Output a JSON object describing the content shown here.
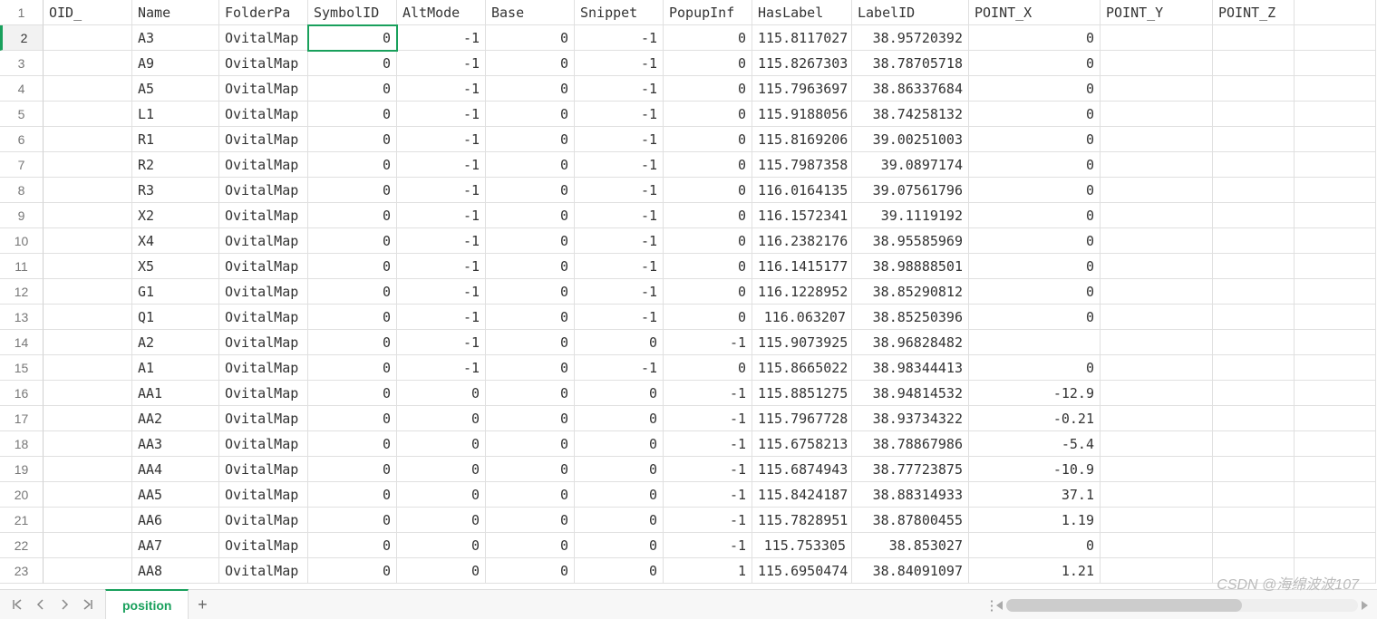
{
  "columns": [
    "OID_",
    "Name",
    "FolderPa",
    "SymbolID",
    "AltMode",
    "Base",
    "Snippet",
    "PopupInf",
    "HasLabel",
    "LabelID",
    "POINT_X",
    "POINT_Y",
    "POINT_Z"
  ],
  "sheet_tab": "position",
  "watermark": "CSDN @海绵波波107",
  "active_row_header": 2,
  "active_col_index": 3,
  "rows": [
    {
      "n": 1,
      "oid": "",
      "name": "",
      "folder": "",
      "sym": "",
      "alt": "",
      "base": "",
      "snip": "",
      "popup": "",
      "haslbl": "",
      "lbl": "",
      "px": "",
      "py": "",
      "pz": ""
    },
    {
      "n": 2,
      "oid": "",
      "name": "A3",
      "folder": "OvitalMap",
      "sym": "0",
      "alt": "-1",
      "base": "0",
      "snip": "-1",
      "popup": "0",
      "haslbl": "115.8117027",
      "lbl": "38.95720392",
      "px": "0",
      "py": "",
      "pz": ""
    },
    {
      "n": 3,
      "oid": "",
      "name": "A9",
      "folder": "OvitalMap",
      "sym": "0",
      "alt": "-1",
      "base": "0",
      "snip": "-1",
      "popup": "0",
      "haslbl": "115.8267303",
      "lbl": "38.78705718",
      "px": "0",
      "py": "",
      "pz": ""
    },
    {
      "n": 4,
      "oid": "",
      "name": "A5",
      "folder": "OvitalMap",
      "sym": "0",
      "alt": "-1",
      "base": "0",
      "snip": "-1",
      "popup": "0",
      "haslbl": "115.7963697",
      "lbl": "38.86337684",
      "px": "0",
      "py": "",
      "pz": ""
    },
    {
      "n": 5,
      "oid": "",
      "name": "L1",
      "folder": "OvitalMap",
      "sym": "0",
      "alt": "-1",
      "base": "0",
      "snip": "-1",
      "popup": "0",
      "haslbl": "115.9188056",
      "lbl": "38.74258132",
      "px": "0",
      "py": "",
      "pz": ""
    },
    {
      "n": 6,
      "oid": "",
      "name": "R1",
      "folder": "OvitalMap",
      "sym": "0",
      "alt": "-1",
      "base": "0",
      "snip": "-1",
      "popup": "0",
      "haslbl": "115.8169206",
      "lbl": "39.00251003",
      "px": "0",
      "py": "",
      "pz": ""
    },
    {
      "n": 7,
      "oid": "",
      "name": "R2",
      "folder": "OvitalMap",
      "sym": "0",
      "alt": "-1",
      "base": "0",
      "snip": "-1",
      "popup": "0",
      "haslbl": "115.7987358",
      "lbl": "39.0897174",
      "px": "0",
      "py": "",
      "pz": ""
    },
    {
      "n": 8,
      "oid": "",
      "name": "R3",
      "folder": "OvitalMap",
      "sym": "0",
      "alt": "-1",
      "base": "0",
      "snip": "-1",
      "popup": "0",
      "haslbl": "116.0164135",
      "lbl": "39.07561796",
      "px": "0",
      "py": "",
      "pz": ""
    },
    {
      "n": 9,
      "oid": "",
      "name": "X2",
      "folder": "OvitalMap",
      "sym": "0",
      "alt": "-1",
      "base": "0",
      "snip": "-1",
      "popup": "0",
      "haslbl": "116.1572341",
      "lbl": "39.1119192",
      "px": "0",
      "py": "",
      "pz": ""
    },
    {
      "n": 10,
      "oid": "",
      "name": "X4",
      "folder": "OvitalMap",
      "sym": "0",
      "alt": "-1",
      "base": "0",
      "snip": "-1",
      "popup": "0",
      "haslbl": "116.2382176",
      "lbl": "38.95585969",
      "px": "0",
      "py": "",
      "pz": ""
    },
    {
      "n": 11,
      "oid": "",
      "name": "X5",
      "folder": "OvitalMap",
      "sym": "0",
      "alt": "-1",
      "base": "0",
      "snip": "-1",
      "popup": "0",
      "haslbl": "116.1415177",
      "lbl": "38.98888501",
      "px": "0",
      "py": "",
      "pz": ""
    },
    {
      "n": 12,
      "oid": "",
      "name": "G1",
      "folder": "OvitalMap",
      "sym": "0",
      "alt": "-1",
      "base": "0",
      "snip": "-1",
      "popup": "0",
      "haslbl": "116.1228952",
      "lbl": "38.85290812",
      "px": "0",
      "py": "",
      "pz": ""
    },
    {
      "n": 13,
      "oid": "",
      "name": "Q1",
      "folder": "OvitalMap",
      "sym": "0",
      "alt": "-1",
      "base": "0",
      "snip": "-1",
      "popup": "0",
      "haslbl": "116.063207",
      "lbl": "38.85250396",
      "px": "0",
      "py": "",
      "pz": ""
    },
    {
      "n": 14,
      "oid": "",
      "name": "A2",
      "folder": "OvitalMap",
      "sym": "0",
      "alt": "-1",
      "base": "0",
      "snip": "0",
      "popup": "-1",
      "haslbl": "115.9073925",
      "lbl": "38.96828482",
      "px": "",
      "py": "",
      "pz": ""
    },
    {
      "n": 15,
      "oid": "",
      "name": "A1",
      "folder": "OvitalMap",
      "sym": "0",
      "alt": "-1",
      "base": "0",
      "snip": "-1",
      "popup": "0",
      "haslbl": "115.8665022",
      "lbl": "38.98344413",
      "px": "0",
      "py": "",
      "pz": ""
    },
    {
      "n": 16,
      "oid": "",
      "name": "AA1",
      "folder": "OvitalMap",
      "sym": "0",
      "alt": "0",
      "base": "0",
      "snip": "0",
      "popup": "-1",
      "haslbl": "115.8851275",
      "lbl": "38.94814532",
      "px": "-12.9",
      "py": "",
      "pz": ""
    },
    {
      "n": 17,
      "oid": "",
      "name": "AA2",
      "folder": "OvitalMap",
      "sym": "0",
      "alt": "0",
      "base": "0",
      "snip": "0",
      "popup": "-1",
      "haslbl": "115.7967728",
      "lbl": "38.93734322",
      "px": "-0.21",
      "py": "",
      "pz": ""
    },
    {
      "n": 18,
      "oid": "",
      "name": "AA3",
      "folder": "OvitalMap",
      "sym": "0",
      "alt": "0",
      "base": "0",
      "snip": "0",
      "popup": "-1",
      "haslbl": "115.6758213",
      "lbl": "38.78867986",
      "px": "-5.4",
      "py": "",
      "pz": ""
    },
    {
      "n": 19,
      "oid": "",
      "name": "AA4",
      "folder": "OvitalMap",
      "sym": "0",
      "alt": "0",
      "base": "0",
      "snip": "0",
      "popup": "-1",
      "haslbl": "115.6874943",
      "lbl": "38.77723875",
      "px": "-10.9",
      "py": "",
      "pz": ""
    },
    {
      "n": 20,
      "oid": "",
      "name": "AA5",
      "folder": "OvitalMap",
      "sym": "0",
      "alt": "0",
      "base": "0",
      "snip": "0",
      "popup": "-1",
      "haslbl": "115.8424187",
      "lbl": "38.88314933",
      "px": "37.1",
      "py": "",
      "pz": ""
    },
    {
      "n": 21,
      "oid": "",
      "name": "AA6",
      "folder": "OvitalMap",
      "sym": "0",
      "alt": "0",
      "base": "0",
      "snip": "0",
      "popup": "-1",
      "haslbl": "115.7828951",
      "lbl": "38.87800455",
      "px": "1.19",
      "py": "",
      "pz": ""
    },
    {
      "n": 22,
      "oid": "",
      "name": "AA7",
      "folder": "OvitalMap",
      "sym": "0",
      "alt": "0",
      "base": "0",
      "snip": "0",
      "popup": "-1",
      "haslbl": "115.753305",
      "lbl": "38.853027",
      "px": "0",
      "py": "",
      "pz": ""
    },
    {
      "n": 23,
      "oid": "",
      "name": "AA8",
      "folder": "OvitalMap",
      "sym": "0",
      "alt": "0",
      "base": "0",
      "snip": "0",
      "popup": "1",
      "haslbl": "115.6950474",
      "lbl": "38.84091097",
      "px": "1.21",
      "py": "",
      "pz": ""
    }
  ],
  "nav": {
    "first": "|◀",
    "prev": "◀",
    "next": "▶",
    "last": "▶|",
    "add": "+"
  }
}
